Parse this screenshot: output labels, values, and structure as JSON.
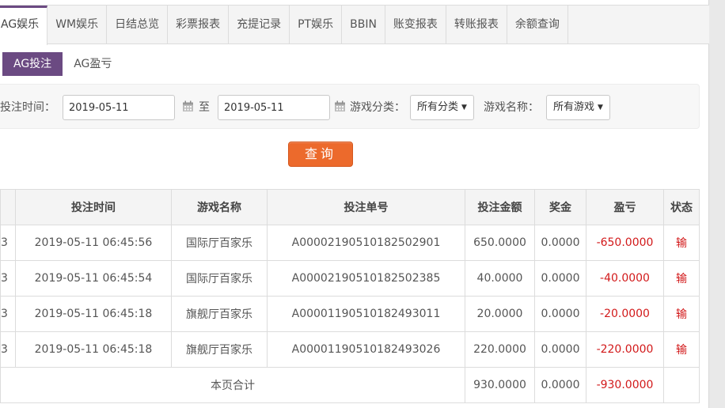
{
  "top_tabs": [
    "AG娱乐",
    "WM娱乐",
    "日结总览",
    "彩票报表",
    "充提记录",
    "PT娱乐",
    "BBIN",
    "账变报表",
    "转账报表",
    "余额查询"
  ],
  "sub_tabs": [
    "AG投注",
    "AG盈亏"
  ],
  "filters": {
    "bet_time_label": "投注时间：",
    "date_from": "2019-05-11",
    "to_label": "至",
    "date_to": "2019-05-11",
    "game_category_label": "游戏分类：",
    "game_category_value": "所有分类",
    "game_name_label": "游戏名称：",
    "game_name_value": "所有游戏",
    "query_button": "查询"
  },
  "table": {
    "headers": [
      "",
      "投注时间",
      "游戏名称",
      "投注单号",
      "投注金额",
      "奖金",
      "盈亏",
      "状态"
    ],
    "rows": [
      [
        "3",
        "2019-05-11 06:45:56",
        "国际厅百家乐",
        "A00002190510182502901",
        "650.0000",
        "0.0000",
        "-650.0000",
        "输"
      ],
      [
        "3",
        "2019-05-11 06:45:54",
        "国际厅百家乐",
        "A00002190510182502385",
        "40.0000",
        "0.0000",
        "-40.0000",
        "输"
      ],
      [
        "3",
        "2019-05-11 06:45:18",
        "旗舰厅百家乐",
        "A00001190510182493011",
        "20.0000",
        "0.0000",
        "-20.0000",
        "输"
      ],
      [
        "3",
        "2019-05-11 06:45:18",
        "旗舰厅百家乐",
        "A00001190510182493026",
        "220.0000",
        "0.0000",
        "-220.0000",
        "输"
      ]
    ],
    "total": {
      "label": "本页合计",
      "bet_amount": "930.0000",
      "bonus": "0.0000",
      "profit": "-930.0000"
    }
  },
  "colors": {
    "accent": "#6b4a82",
    "button": "#ec6a2c",
    "loss": "#d2191a"
  }
}
